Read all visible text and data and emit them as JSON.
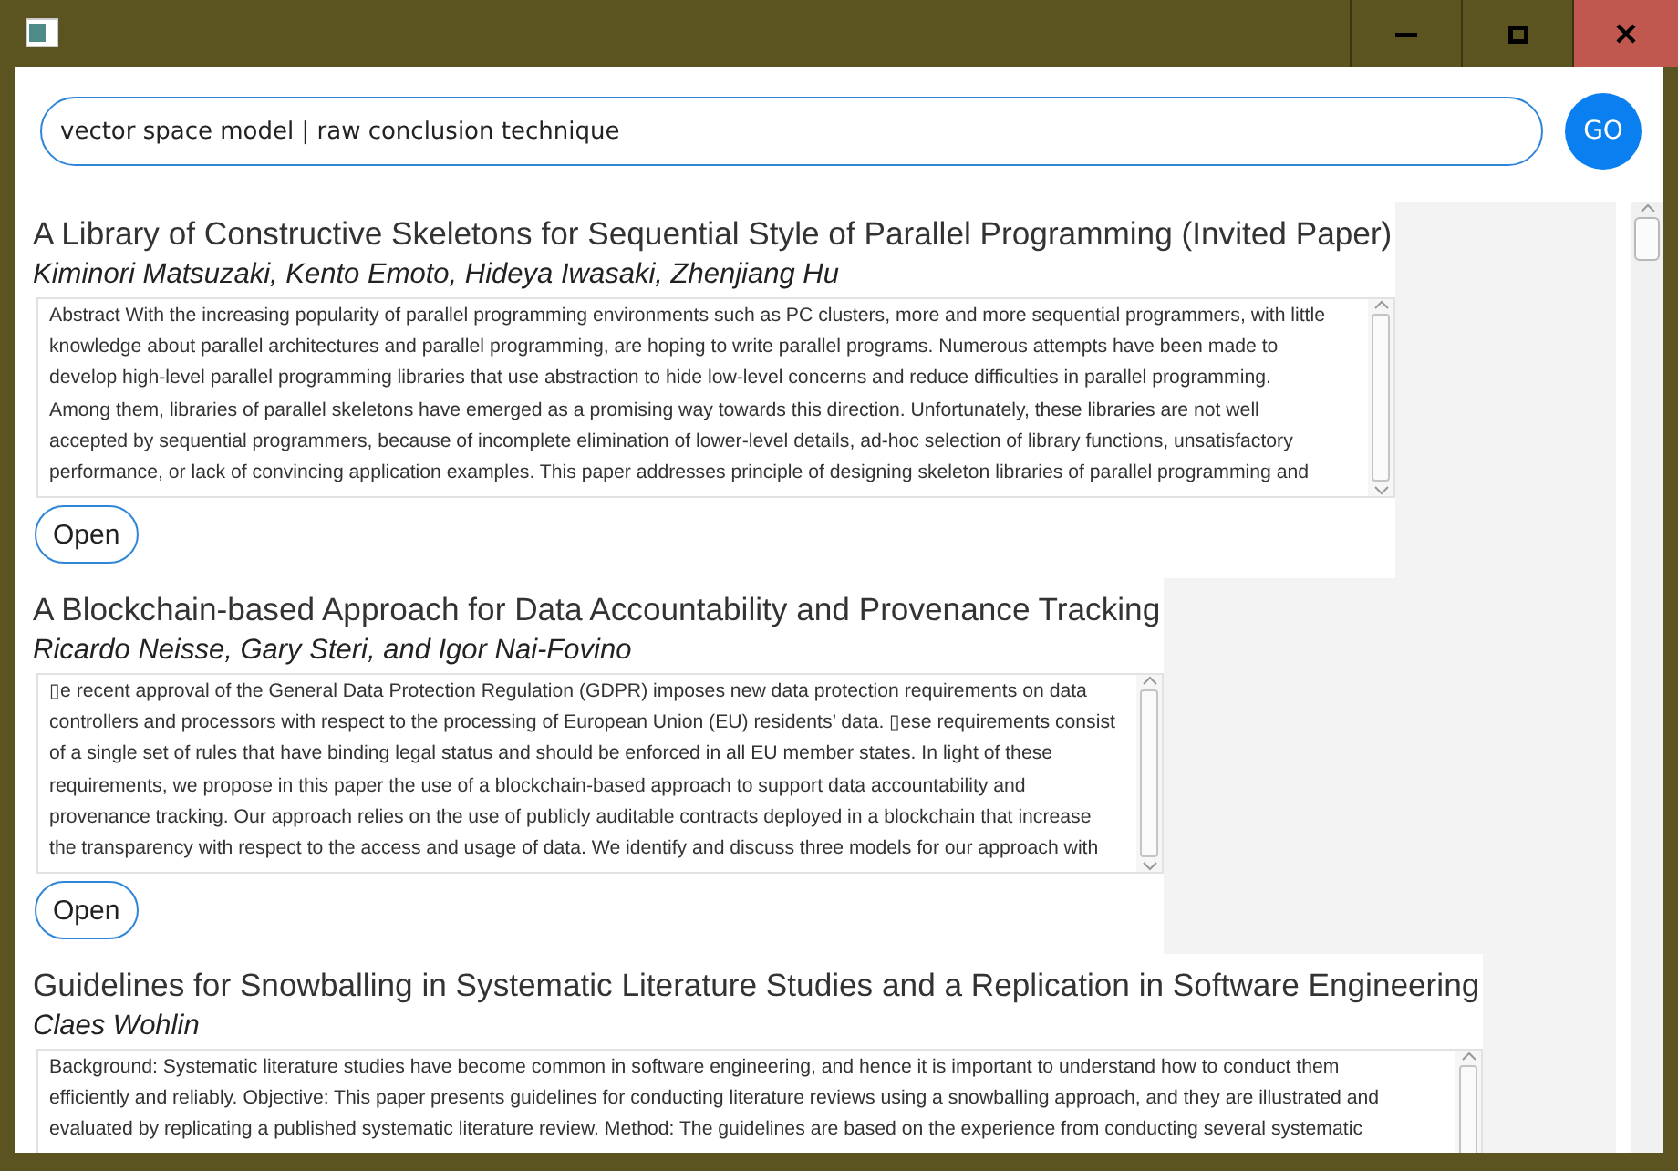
{
  "search": {
    "value": "vector space model | raw conclusion technique",
    "button": "GO"
  },
  "results": [
    {
      "title": "A Library of Constructive Skeletons for Sequential Style of Parallel Programming (Invited Paper)",
      "authors": "Kiminori Matsuzaki, Kento Emoto, Hideya Iwasaki, Zhenjiang Hu",
      "abstract": [
        "Abstract With the increasing popularity of parallel programming environments such as PC clusters, more and more sequential programmers, with little",
        "knowledge about parallel architectures and parallel programming, are hoping to write parallel programs. Numerous attempts have been made to",
        "develop high-level parallel programming libraries that use abstraction to hide low-level concerns and reduce difficulties in parallel programming.",
        "Among them, libraries of parallel skeletons have emerged as a promising way towards this direction. Unfortunately, these libraries are not well",
        "accepted by sequential programmers, because of incomplete elimination of lower-level details, ad-hoc selection of library functions, unsatisfactory",
        "performance, or lack of convincing application examples. This paper addresses principle of designing skeleton libraries of parallel programming and"
      ],
      "button": "Open"
    },
    {
      "title": "A Blockchain-based Approach for Data Accountability and Provenance Tracking",
      "authors": "Ricardo Neisse, Gary Steri, and Igor Nai-Fovino",
      "abstract": [
        "▯e recent approval of the General Data Protection Regulation (GDPR) imposes new data protection requirements on data",
        "controllers and processors with respect to the processing of European Union (EU) residents’ data. ▯ese requirements consist",
        "of a single set of rules that have binding legal status and should be enforced in all EU member states. In light of these",
        "requirements, we propose in this paper the use of a blockchain-based approach to support data accountability and",
        "provenance tracking. Our approach relies on the use of publicly auditable contracts deployed in a blockchain that increase",
        "the transparency with respect to the access and usage of data. We identify and discuss three models for our approach with"
      ],
      "button": "Open"
    },
    {
      "title": "Guidelines for Snowballing in Systematic Literature Studies and a Replication in Software Engineering",
      "authors": "Claes Wohlin",
      "abstract": [
        "Background: Systematic literature studies have become common in software engineering, and hence it is important to understand how to conduct them",
        "efficiently and reliably. Objective: This paper presents guidelines for conducting literature reviews using a snowballing approach, and they are illustrated and",
        "evaluated by replicating a published systematic literature review. Method: The guidelines are based on the experience from conducting several systematic"
      ]
    }
  ]
}
